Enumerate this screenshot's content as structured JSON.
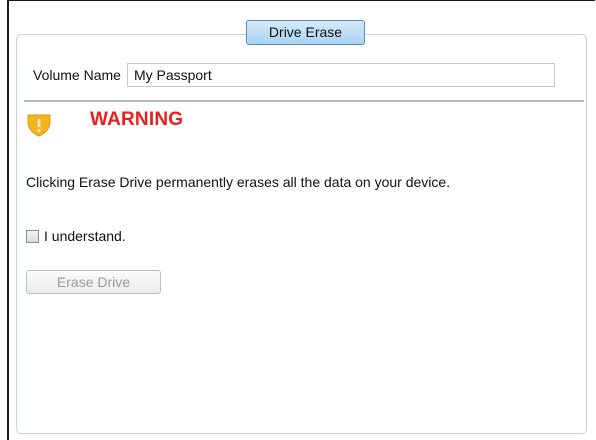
{
  "tab": {
    "label": "Drive Erase"
  },
  "volume": {
    "label": "Volume Name",
    "value": "My Passport"
  },
  "warning": {
    "icon": "warning-shield-icon",
    "title": "WARNING",
    "message": "Clicking Erase Drive permanently erases all the data on your device."
  },
  "confirm": {
    "label": "I understand.",
    "checked": false
  },
  "erase_button": {
    "label": "Erase Drive",
    "enabled": false
  },
  "colors": {
    "warning_text": "#ee1c1c",
    "warning_icon": "#f7b51c",
    "tab_fill": "#a9d2f2"
  }
}
